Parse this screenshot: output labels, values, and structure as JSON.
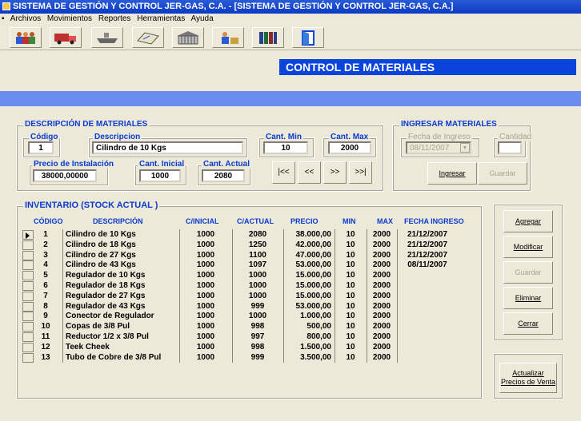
{
  "window": {
    "title": "SISTEMA DE GESTIÓN Y CONTROL JER-GAS, C.A. - [SISTEMA DE GESTIÓN Y CONTROL JER-GAS, C.A.]"
  },
  "menu": {
    "items": [
      "Archivos",
      "Movimientos",
      "Reportes",
      "Herramientas",
      "Ayuda"
    ]
  },
  "toolbar": {
    "icons": [
      "people-icon",
      "truck-icon",
      "ship-icon",
      "map-icon",
      "warehouse-icon",
      "worker-icon",
      "books-icon",
      "door-icon"
    ]
  },
  "banner": {
    "title": "CONTROL DE MATERIALES"
  },
  "materials": {
    "title": "DESCRIPCIÓN DE MATERIALES",
    "codigo_label": "Código",
    "codigo": "1",
    "descripcion_label": "Descripcion",
    "descripcion": "Cilindro de 10 Kgs",
    "cant_min_label": "Cant. Min",
    "cant_min": "10",
    "cant_max_label": "Cant. Max",
    "cant_max": "2000",
    "precio_label": "Precio de Instalación",
    "precio": "38000,00000",
    "cant_inicial_label": "Cant. Inicial",
    "cant_inicial": "1000",
    "cant_actual_label": "Cant. Actual",
    "cant_actual": "2080",
    "nav": {
      "first": "|<<",
      "prev": "<<",
      "next": ">>",
      "last": ">>|"
    }
  },
  "ingresar": {
    "title": "INGRESAR MATERIALES",
    "fecha_label": "Fecha de Ingreso",
    "fecha": "08/11/2007",
    "cantidad_label": "Cantidad",
    "cantidad": "",
    "ingresar_btn": "Ingresar",
    "guardar_btn": "Guardar"
  },
  "inventory": {
    "title": "INVENTARIO (STOCK ACTUAL )",
    "headers": {
      "codigo": "CÓDIGO",
      "descripcion": "DESCRIPCIÓN",
      "cinicial": "C/INICIAL",
      "cactual": "C/ACTUAL",
      "precio": "PRECIO",
      "min": "MIN",
      "max": "MAX",
      "fecha": "FECHA INGRESO"
    },
    "rows": [
      {
        "codigo": "1",
        "descripcion": "Cilindro de 10 Kgs",
        "cinicial": "1000",
        "cactual": "2080",
        "precio": "38.000,00",
        "min": "10",
        "max": "2000",
        "fecha": "21/12/2007"
      },
      {
        "codigo": "2",
        "descripcion": "Cilindro de 18 Kgs",
        "cinicial": "1000",
        "cactual": "1250",
        "precio": "42.000,00",
        "min": "10",
        "max": "2000",
        "fecha": "21/12/2007"
      },
      {
        "codigo": "3",
        "descripcion": "Cilindro de 27 Kgs",
        "cinicial": "1000",
        "cactual": "1100",
        "precio": "47.000,00",
        "min": "10",
        "max": "2000",
        "fecha": "21/12/2007"
      },
      {
        "codigo": "4",
        "descripcion": "Cilindro de 43 Kgs",
        "cinicial": "1000",
        "cactual": "1097",
        "precio": "53.000,00",
        "min": "10",
        "max": "2000",
        "fecha": "08/11/2007"
      },
      {
        "codigo": "5",
        "descripcion": "Regulador de 10 Kgs",
        "cinicial": "1000",
        "cactual": "1000",
        "precio": "15.000,00",
        "min": "10",
        "max": "2000",
        "fecha": ""
      },
      {
        "codigo": "6",
        "descripcion": "Regulador de 18 Kgs",
        "cinicial": "1000",
        "cactual": "1000",
        "precio": "15.000,00",
        "min": "10",
        "max": "2000",
        "fecha": ""
      },
      {
        "codigo": "7",
        "descripcion": "Regulador de 27 Kgs",
        "cinicial": "1000",
        "cactual": "1000",
        "precio": "15.000,00",
        "min": "10",
        "max": "2000",
        "fecha": ""
      },
      {
        "codigo": "8",
        "descripcion": "Regulador de 43 Kgs",
        "cinicial": "1000",
        "cactual": "999",
        "precio": "53.000,00",
        "min": "10",
        "max": "2000",
        "fecha": ""
      },
      {
        "codigo": "9",
        "descripcion": "Conector de Regulador",
        "cinicial": "1000",
        "cactual": "1000",
        "precio": "1.000,00",
        "min": "10",
        "max": "2000",
        "fecha": ""
      },
      {
        "codigo": "10",
        "descripcion": "Copas de 3/8 Pul",
        "cinicial": "1000",
        "cactual": "998",
        "precio": "500,00",
        "min": "10",
        "max": "2000",
        "fecha": ""
      },
      {
        "codigo": "11",
        "descripcion": "Reductor 1/2 x 3/8 Pul",
        "cinicial": "1000",
        "cactual": "997",
        "precio": "800,00",
        "min": "10",
        "max": "2000",
        "fecha": ""
      },
      {
        "codigo": "12",
        "descripcion": "Teek Cheek",
        "cinicial": "1000",
        "cactual": "998",
        "precio": "1.500,00",
        "min": "10",
        "max": "2000",
        "fecha": ""
      },
      {
        "codigo": "13",
        "descripcion": "Tubo de Cobre de 3/8 Pul",
        "cinicial": "1000",
        "cactual": "999",
        "precio": "3.500,00",
        "min": "10",
        "max": "2000",
        "fecha": ""
      }
    ]
  },
  "actions": {
    "agregar": "Agregar",
    "modificar": "Modificar",
    "guardar": "Guardar",
    "eliminar": "Eliminar",
    "cerrar": "Cerrar",
    "actualizar": "Actualizar Precios de Venta"
  }
}
